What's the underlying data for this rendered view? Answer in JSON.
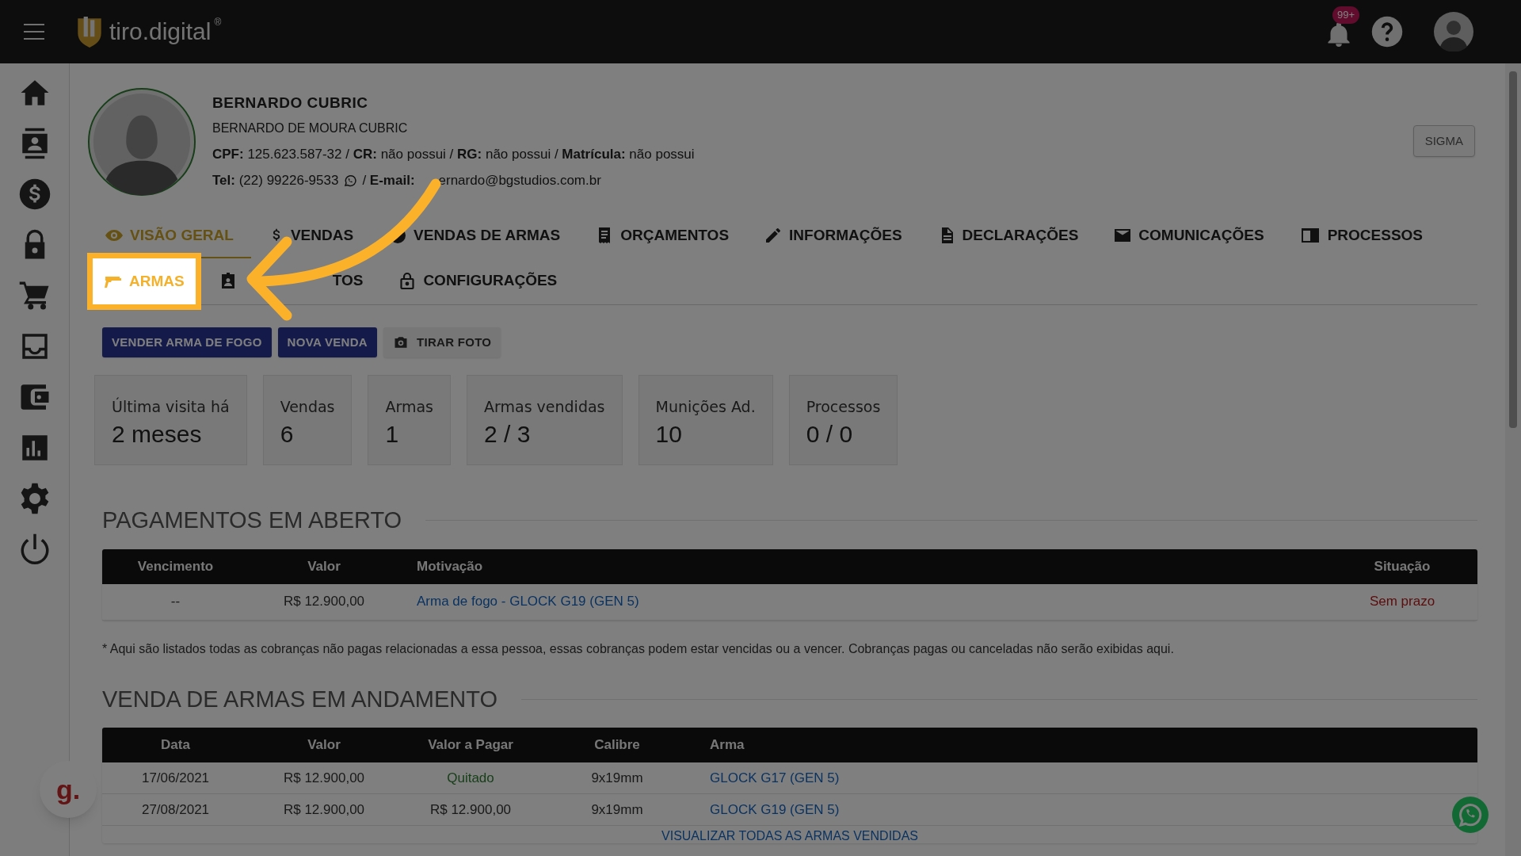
{
  "header": {
    "logo": "tiro.digital",
    "logo_mark": "®",
    "notifications": "99+"
  },
  "profile": {
    "name": "BERNARDO CUBRIC",
    "full_name": "BERNARDO DE MOURA CUBRIC",
    "documents": "**CPF:** 125.623.587-32 / **CR:** não possui / **RG:** não possui / **Matrícula:** não possui",
    "phone": "**Tel:** (22) 99226-9533",
    "email_label": "/ **E-mail:**",
    "email": "ernardo@bgstudios.com.br",
    "action": "SIGMA"
  },
  "tabs": [
    [
      {
        "label": "VISÃO GERAL",
        "kind": "eye",
        "selected": true,
        "highlighted": false
      },
      {
        "label": "VENDAS",
        "kind": "dollar",
        "selected": false,
        "highlighted": false
      },
      {
        "label": "VENDAS DE ARMAS",
        "kind": "circle",
        "selected": false,
        "highlighted": false
      },
      {
        "label": "ORÇAMENTOS",
        "kind": "receipt",
        "selected": false,
        "highlighted": false
      },
      {
        "label": "INFORMAÇÕES",
        "kind": "pencil",
        "selected": false,
        "highlighted": false
      },
      {
        "label": "DECLARAÇÕES",
        "kind": "file",
        "selected": false,
        "highlighted": false
      },
      {
        "label": "COMUNICAÇÕES",
        "kind": "envelope",
        "selected": false,
        "highlighted": false
      },
      {
        "label": "PROCESSOS",
        "kind": "monitor",
        "selected": false,
        "highlighted": false
      }
    ],
    [
      {
        "label": "ARMAS",
        "kind": "gun",
        "selected": false,
        "highlighted": true
      },
      {
        "label": "TOS",
        "kind": "badge",
        "selected": false,
        "highlighted": false
      },
      {
        "label": "CONFIGURAÇÕES",
        "kind": "lock",
        "selected": false,
        "highlighted": false
      }
    ]
  ],
  "buttons": [
    {
      "label": "VENDER ARMA DE FOGO",
      "kind": "primary"
    },
    {
      "label": "NOVA VENDA",
      "kind": "primary"
    },
    {
      "label": "TIRAR FOTO",
      "kind": "camera"
    }
  ],
  "stats": [
    {
      "label": "Última visita há",
      "value": "2 meses"
    },
    {
      "label": "Vendas",
      "value": "6"
    },
    {
      "label": "Armas",
      "value": "1"
    },
    {
      "label": "Armas vendidas",
      "value": "2 / 3"
    },
    {
      "label": "Munições Ad.",
      "value": "10"
    },
    {
      "label": "Processos",
      "value": "0 / 0"
    }
  ],
  "payments": {
    "title": "PAGAMENTOS EM ABERTO",
    "columns": [
      "Vencimento",
      "Valor",
      "Motivação",
      "Situação"
    ],
    "rows": [
      [
        {
          "text": "--"
        },
        {
          "text": "R$ 12.900,00"
        },
        {
          "text": "Arma de fogo - GLOCK G19 (GEN 5)",
          "kind": "link"
        },
        {
          "text": "Sem prazo",
          "kind": "warning"
        }
      ]
    ],
    "note": "* Aqui são listados todas as cobranças não pagas relacionadas a essa pessoa, essas cobranças podem estar vencidas ou a vencer. Cobranças pagas ou canceladas não serão exibidas aqui."
  },
  "weapon_sales": {
    "title": "VENDA DE ARMAS EM ANDAMENTO",
    "columns": [
      "Data",
      "Valor",
      "Valor a Pagar",
      "Calibre",
      "Arma"
    ],
    "rows": [
      [
        {
          "text": "17/06/2021"
        },
        {
          "text": "R$ 12.900,00"
        },
        {
          "text": "Quitado",
          "kind": "success"
        },
        {
          "text": "9x19mm"
        },
        {
          "text": "GLOCK G17 (GEN 5)",
          "kind": "link"
        }
      ],
      [
        {
          "text": "27/08/2021"
        },
        {
          "text": "R$ 12.900,00"
        },
        {
          "text": "R$ 12.900,00"
        },
        {
          "text": "9x19mm"
        },
        {
          "text": "GLOCK G19 (GEN 5)",
          "kind": "link"
        }
      ]
    ],
    "link": "VISUALIZAR TODAS AS ARMAS VENDIDAS"
  },
  "chat_button": "g."
}
